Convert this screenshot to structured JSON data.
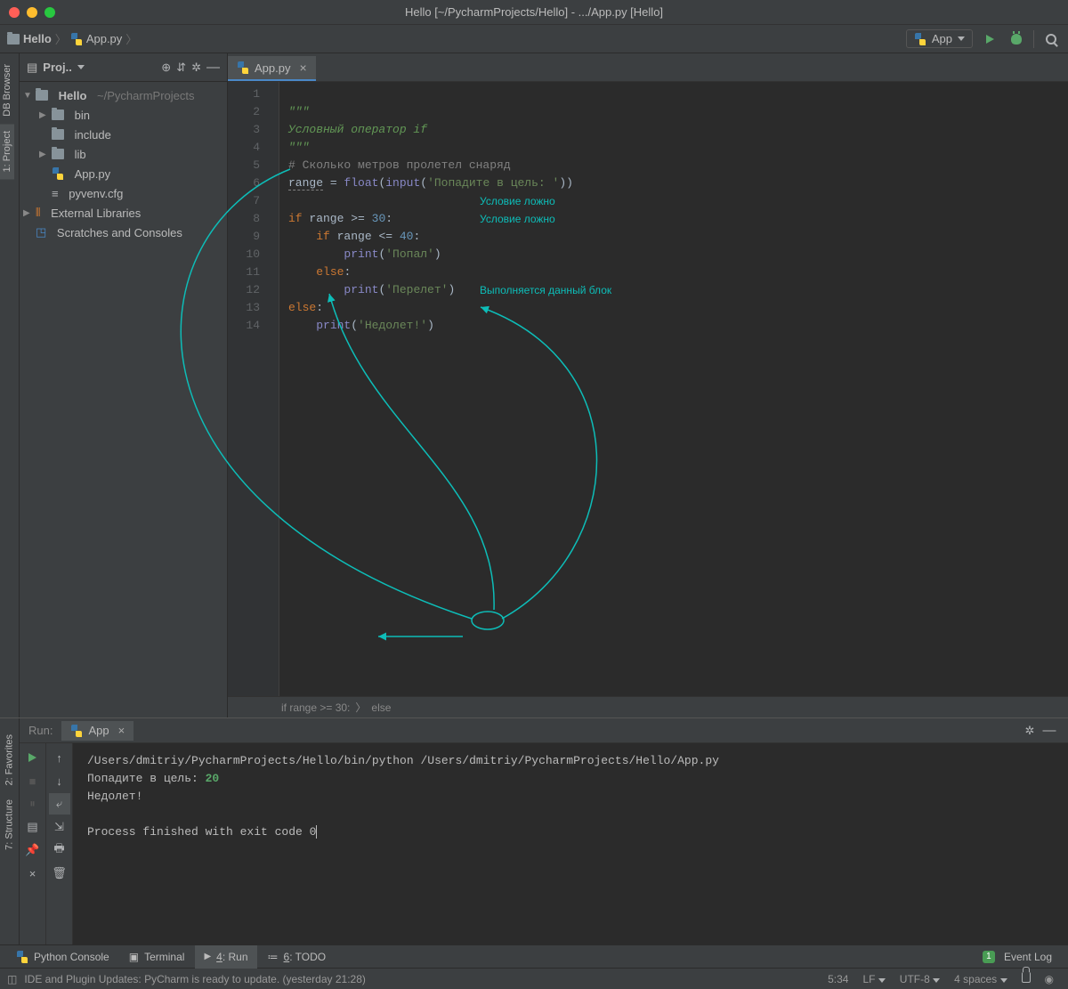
{
  "title_bar": {
    "text": "Hello [~/PycharmProjects/Hello] - .../App.py [Hello]"
  },
  "breadcrumbs": {
    "project": "Hello",
    "file": "App.py"
  },
  "run_config": {
    "label": "App"
  },
  "left_gutter": {
    "db": "DB Browser",
    "project": "1: Project",
    "favorites": "2: Favorites",
    "structure": "7: Structure"
  },
  "project_panel": {
    "title": "Proj..",
    "tree": {
      "root": "Hello",
      "root_path": "~/PycharmProjects",
      "bin": "bin",
      "include": "include",
      "lib": "lib",
      "app": "App.py",
      "pyvenv": "pyvenv.cfg",
      "ext": "External Libraries",
      "scratch": "Scratches and Consoles"
    }
  },
  "tab": {
    "name": "App.py"
  },
  "code": {
    "l1": "\"\"\"",
    "l2": "Условный оператор if",
    "l3": "\"\"\"",
    "l4_cmt": "# Сколько метров пролетел снаряд",
    "l5_var": "range",
    "l5_float": "float",
    "l5_input": "input",
    "l5_str": "'Попадите в цель: '",
    "l7_if": "if ",
    "l7_cond": "range",
    "l7_op": " >= ",
    "l7_num": "30",
    "l8_if": "if ",
    "l8_cond": "range",
    "l8_op": " <= ",
    "l8_num": "40",
    "l9_print": "print",
    "l9_str": "'Попал'",
    "l10_else": "else",
    "l11_print": "print",
    "l11_str": "'Перелет'",
    "l12_else": "else",
    "l13_print": "print",
    "l13_str": "'Недолет!'",
    "annot1": "Условие ложно",
    "annot2": "Условие ложно",
    "annot3": "Выполняется данный блок"
  },
  "line_numbers": [
    "1",
    "2",
    "3",
    "4",
    "5",
    "6",
    "7",
    "8",
    "9",
    "10",
    "11",
    "12",
    "13",
    "14"
  ],
  "code_breadcrumb": {
    "a": "if range >= 30:",
    "b": "else"
  },
  "run_panel": {
    "label": "Run:",
    "tab": "App",
    "cmd": "/Users/dmitriy/PycharmProjects/Hello/bin/python /Users/dmitriy/PycharmProjects/Hello/App.py",
    "prompt": "Попадите в цель: ",
    "input_val": "20",
    "output": "Недолет!",
    "exit": "Process finished with exit code 0"
  },
  "bottom_tools": {
    "console": "Python Console",
    "terminal": "Terminal",
    "run_n": "4",
    "run_l": ": Run",
    "todo_n": "6",
    "todo_l": ": TODO",
    "event": "Event Log"
  },
  "status": {
    "msg": "IDE and Plugin Updates: PyCharm is ready to update. (yesterday 21:28)",
    "pos": "5:34",
    "le": "LF",
    "enc": "UTF-8",
    "indent": "4 spaces"
  }
}
